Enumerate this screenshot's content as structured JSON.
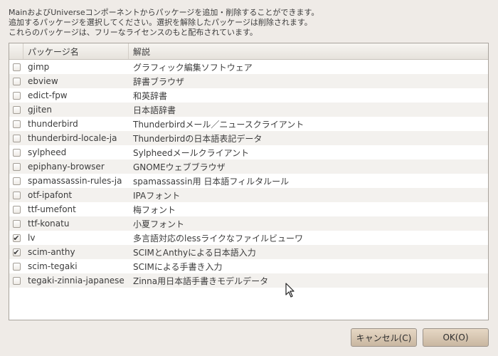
{
  "description": {
    "lines": [
      "MainおよびUniverseコンポーネントからパッケージを追加・削除することができます。",
      "追加するパッケージを選択してください。選択を解除したパッケージは削除されます。",
      "これらのパッケージは、フリーなライセンスのもと配布されています。"
    ]
  },
  "table": {
    "columns": {
      "name": "パッケージ名",
      "description": "解説"
    },
    "rows": [
      {
        "checked": false,
        "name": "gimp",
        "description": "グラフィック編集ソフトウェア"
      },
      {
        "checked": false,
        "name": "ebview",
        "description": "辞書ブラウザ"
      },
      {
        "checked": false,
        "name": "edict-fpw",
        "description": "和英辞書"
      },
      {
        "checked": false,
        "name": "gjiten",
        "description": "日本語辞書"
      },
      {
        "checked": false,
        "name": "thunderbird",
        "description": "Thunderbirdメール／ニュースクライアント"
      },
      {
        "checked": false,
        "name": "thunderbird-locale-ja",
        "description": "Thunderbirdの日本語表記データ"
      },
      {
        "checked": false,
        "name": "sylpheed",
        "description": "Sylpheedメールクライアント"
      },
      {
        "checked": false,
        "name": "epiphany-browser",
        "description": "GNOMEウェブブラウザ"
      },
      {
        "checked": false,
        "name": "spamassassin-rules-ja",
        "description": "spamassassin用 日本語フィルタルール"
      },
      {
        "checked": false,
        "name": "otf-ipafont",
        "description": "IPAフォント"
      },
      {
        "checked": false,
        "name": "ttf-umefont",
        "description": "梅フォント"
      },
      {
        "checked": false,
        "name": "ttf-konatu",
        "description": "小夏フォント"
      },
      {
        "checked": true,
        "name": "lv",
        "description": "多言語対応のlessライクなファイルビューワ"
      },
      {
        "checked": true,
        "name": "scim-anthy",
        "description": "SCIMとAnthyによる日本語入力"
      },
      {
        "checked": false,
        "name": "scim-tegaki",
        "description": "SCIMによる手書き入力"
      },
      {
        "checked": false,
        "name": "tegaki-zinnia-japanese",
        "description": "Zinna用日本語手書きモデルデータ"
      }
    ]
  },
  "buttons": {
    "cancel": "キャンセル(C)",
    "ok": "OK(O)"
  },
  "colors": {
    "background": "#efebe7",
    "button": "#d6c6b2"
  },
  "icons": {
    "checkmark": "✔",
    "cursor": "arrow-pointer-icon"
  }
}
